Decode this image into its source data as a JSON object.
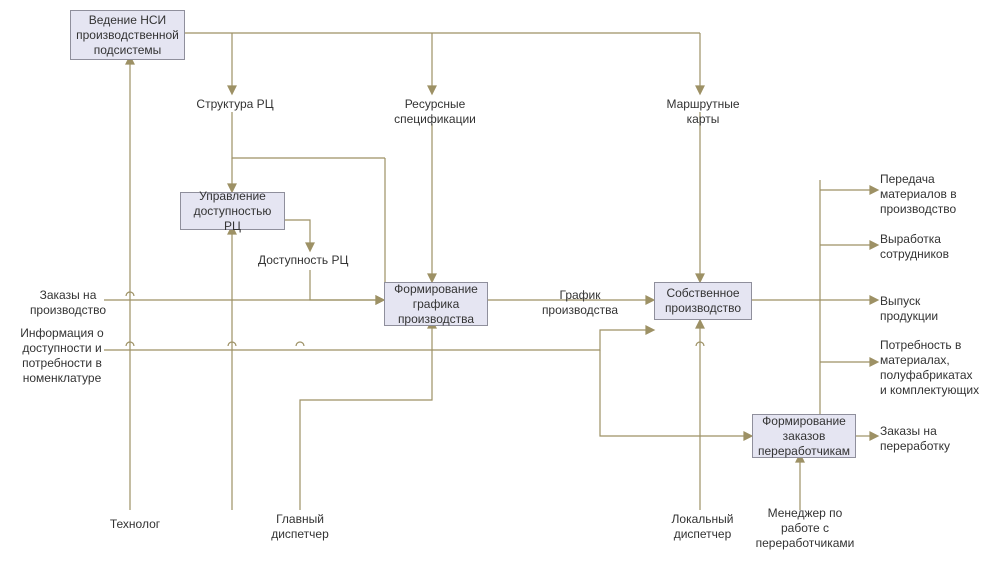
{
  "boxes": {
    "b_hsi": "Ведение НСИ производственной подсистемы",
    "b_avail": "Управление доступностью РЦ",
    "b_sched": "Формирование графика производства",
    "b_prod": "Собственное производство",
    "b_orders": "Формирование заказов переработчикам"
  },
  "labels": {
    "struct_rc": "Структура РЦ",
    "res_spec": "Ресурсные спецификации",
    "route_cards": "Маршрутные карты",
    "avail_rc": "Доступность РЦ",
    "orders_prod": "Заказы на производство",
    "info_avail": "Информация о доступности и потребности в номенклатуре",
    "sched_graph": "График производства",
    "transfer_mat": "Передача материалов в производство",
    "staff_output": "Выработка сотрудников",
    "product_out": "Выпуск продукции",
    "need_mat": "Потребность в материалах, полуфабрикатах и комплектующих",
    "orders_proc": "Заказы на переработку",
    "technologist": "Технолог",
    "chief_disp": "Главный диспетчер",
    "local_disp": "Локальный диспетчер",
    "proc_manager": "Менеджер по работе с переработчиками"
  }
}
